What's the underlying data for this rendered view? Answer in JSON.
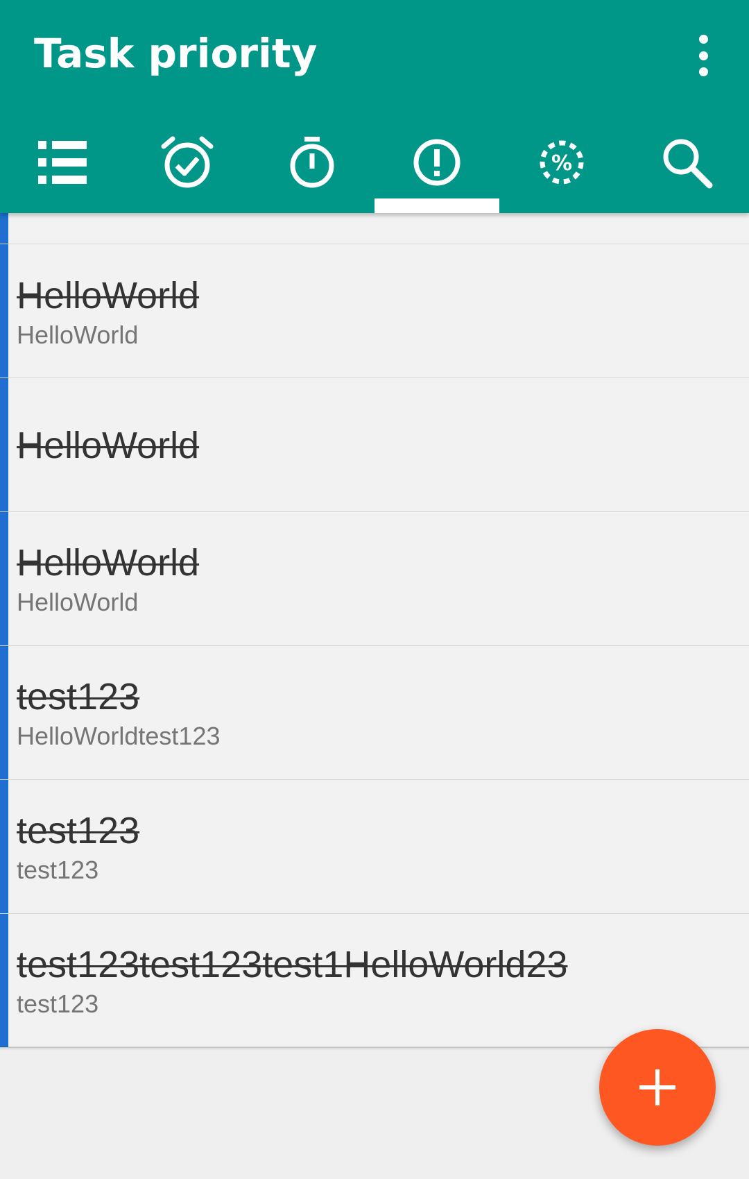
{
  "appbar": {
    "title": "Task priority",
    "background_color": "#009688",
    "overflow_icon": "more-vert-icon"
  },
  "tabs": [
    {
      "id": "all",
      "icon": "list-icon",
      "selected": false
    },
    {
      "id": "reminders",
      "icon": "alarm-check-icon",
      "selected": false
    },
    {
      "id": "timer",
      "icon": "timer-icon",
      "selected": false
    },
    {
      "id": "priority",
      "icon": "priority-icon",
      "selected": true
    },
    {
      "id": "progress",
      "icon": "progress-percent-icon",
      "selected": false
    },
    {
      "id": "search",
      "icon": "search-icon",
      "selected": false
    }
  ],
  "tasks": [
    {
      "title": "",
      "subtitle": ""
    },
    {
      "title": "HelloWorld",
      "subtitle": "HelloWorld"
    },
    {
      "title": "HelloWorld",
      "subtitle": ""
    },
    {
      "title": "HelloWorld",
      "subtitle": "HelloWorld"
    },
    {
      "title": "test123",
      "subtitle": "HelloWorldtest123"
    },
    {
      "title": "test123",
      "subtitle": "test123"
    },
    {
      "title": "test123test123test1HelloWorld23",
      "subtitle": "test123"
    }
  ],
  "colors": {
    "priority_bar": "#1e6fd0",
    "fab": "#ff5722"
  },
  "fab": {
    "icon": "add-icon"
  }
}
